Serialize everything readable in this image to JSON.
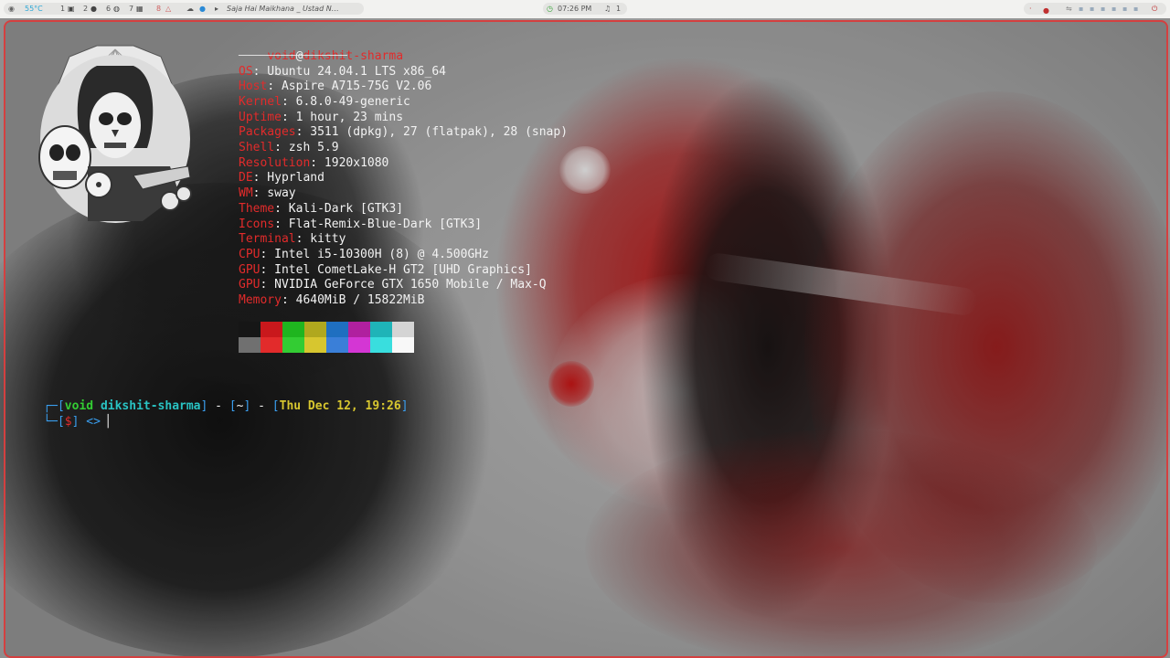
{
  "topbar": {
    "temp": "55°C",
    "workspaces": [
      "1",
      "2",
      "6",
      "7",
      "8"
    ],
    "media_title": "Saja Hai Maikhana _ Ustad N…",
    "clock": "07:26 PM",
    "notifications": "1"
  },
  "fetch": {
    "user": "void",
    "at": "@",
    "host": "dikshit-sharma",
    "separator": "────────────────────",
    "info": [
      {
        "key": "OS",
        "value": ": Ubuntu 24.04.1 LTS x86_64"
      },
      {
        "key": "Host",
        "value": ": Aspire A715-75G V2.06"
      },
      {
        "key": "Kernel",
        "value": ": 6.8.0-49-generic"
      },
      {
        "key": "Uptime",
        "value": ": 1 hour, 23 mins"
      },
      {
        "key": "Packages",
        "value": ": 3511 (dpkg), 27 (flatpak), 28 (snap)"
      },
      {
        "key": "Shell",
        "value": ": zsh 5.9"
      },
      {
        "key": "Resolution",
        "value": ": 1920x1080"
      },
      {
        "key": "DE",
        "value": ": Hyprland"
      },
      {
        "key": "WM",
        "value": ": sway"
      },
      {
        "key": "Theme",
        "value": ": Kali-Dark [GTK3]"
      },
      {
        "key": "Icons",
        "value": ": Flat-Remix-Blue-Dark [GTK3]"
      },
      {
        "key": "Terminal",
        "value": ": kitty"
      },
      {
        "key": "CPU",
        "value": ": Intel i5-10300H (8) @ 4.500GHz"
      },
      {
        "key": "GPU",
        "value": ": Intel CometLake-H GT2 [UHD Graphics]"
      },
      {
        "key": "GPU",
        "value": ": NVIDIA GeForce GTX 1650 Mobile / Max-Q"
      },
      {
        "key": "Memory",
        "value": ": 4640MiB / 15822MiB"
      }
    ],
    "palette_top": [
      "#161616",
      "#c9181c",
      "#1fb51f",
      "#b0a81e",
      "#1f6fc0",
      "#b0209f",
      "#1fb4b8",
      "#d4d4d4"
    ],
    "palette_bottom": [
      "#707070",
      "#e22b2b",
      "#33cc33",
      "#d7c62f",
      "#3a7fd8",
      "#d436d4",
      "#39dede",
      "#f8f8f8"
    ]
  },
  "prompt": {
    "corner_top": "┌─",
    "user": "void",
    "host": "dikshit-sharma",
    "dir": "~",
    "date": "Thu Dec 12, 19:26",
    "corner_bottom": "└─",
    "symbol": "$",
    "arrow": "<>"
  },
  "colors": {
    "accent_red": "#e22b2b",
    "frame_border": "#d44040"
  }
}
